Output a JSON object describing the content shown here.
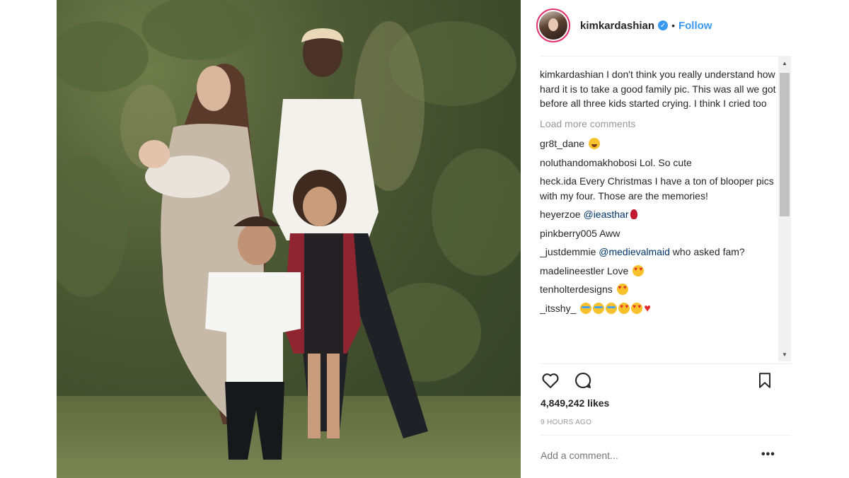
{
  "post": {
    "username": "kimkardashian",
    "verified_icon": "verified-badge-icon",
    "separator": "•",
    "follow_label": "Follow",
    "caption_user": "kimkardashian",
    "caption_text": "I don't think you really understand how hard it is to take a good family pic. This was all we got before all three kids started crying. I think I cried too",
    "load_more": "Load more comments",
    "comments": [
      {
        "user": "gr8t_dane",
        "text": "",
        "mention": "",
        "emojis": [
          "rolling-laughing"
        ]
      },
      {
        "user": "noluthandomakhobosi",
        "text": "Lol. So cute",
        "mention": "",
        "emojis": []
      },
      {
        "user": "heck.ida",
        "text": "Every Christmas I have a ton of blooper pics with my four. Those are the memories!",
        "mention": "",
        "emojis": []
      },
      {
        "user": "heyerzoe",
        "text": "",
        "mention": "@ieasthar",
        "emojis": [
          "rose"
        ]
      },
      {
        "user": "pinkberry005",
        "text": "Aww",
        "mention": "",
        "emojis": []
      },
      {
        "user": "_justdemmie",
        "text": "who asked fam?",
        "mention": "@medievalmaid",
        "emojis": []
      },
      {
        "user": "madelineestler",
        "text": "Love",
        "mention": "",
        "emojis": [
          "heart-eyes"
        ]
      },
      {
        "user": "tenholterdesigns",
        "text": "",
        "mention": "",
        "emojis": [
          "heart-eyes"
        ]
      },
      {
        "user": "_itsshy_",
        "text": "",
        "mention": "",
        "emojis": [
          "tears-of-joy",
          "tears-of-joy",
          "tears-of-joy",
          "heart-eyes",
          "heart-eyes",
          "red-heart"
        ]
      }
    ],
    "likes": "4,849,242 likes",
    "time_ago": "9 HOURS AGO",
    "add_comment_placeholder": "Add a comment...",
    "more_options": "•••"
  },
  "colors": {
    "link_blue": "#3897f0",
    "mention_blue": "#003569",
    "muted_text": "#999999",
    "text": "#262626"
  },
  "icons": [
    "heart-icon",
    "comment-icon",
    "bookmark-icon",
    "verified-badge-icon",
    "scroll-up-arrow-icon",
    "scroll-down-arrow-icon"
  ]
}
